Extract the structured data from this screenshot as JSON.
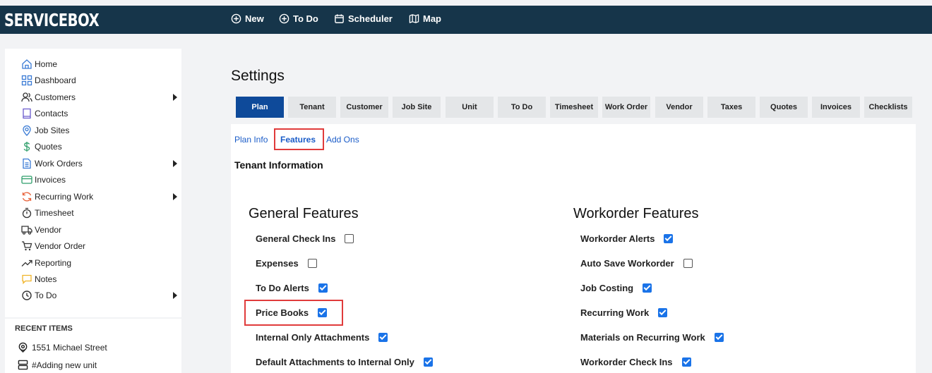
{
  "app": {
    "logo": "SERVICEBOX"
  },
  "topnav": {
    "new": "New",
    "todo": "To Do",
    "scheduler": "Scheduler",
    "map": "Map"
  },
  "sidebar": {
    "items": [
      {
        "label": "Home",
        "icon": "home-icon"
      },
      {
        "label": "Dashboard",
        "icon": "dashboard-icon"
      },
      {
        "label": "Customers",
        "icon": "customers-icon"
      },
      {
        "label": "Contacts",
        "icon": "contacts-icon"
      },
      {
        "label": "Job Sites",
        "icon": "location-pin-icon"
      },
      {
        "label": "Quotes",
        "icon": "dollar-icon"
      },
      {
        "label": "Work Orders",
        "icon": "document-icon"
      },
      {
        "label": "Invoices",
        "icon": "credit-card-icon"
      },
      {
        "label": "Recurring Work",
        "icon": "refresh-icon"
      },
      {
        "label": "Timesheet",
        "icon": "stopwatch-icon"
      },
      {
        "label": "Vendor",
        "icon": "truck-icon"
      },
      {
        "label": "Vendor Order",
        "icon": "cart-icon"
      },
      {
        "label": "Reporting",
        "icon": "trend-icon"
      },
      {
        "label": "Notes",
        "icon": "note-icon"
      },
      {
        "label": "To Do",
        "icon": "clock-icon"
      }
    ]
  },
  "recent": {
    "title": "RECENT ITEMS",
    "items": [
      {
        "label": "1551 Michael Street",
        "icon": "location-pin-icon"
      },
      {
        "label": "#Adding new unit",
        "icon": "server-icon"
      }
    ]
  },
  "page": {
    "title": "Settings"
  },
  "tabs": [
    "Plan",
    "Tenant",
    "Customer",
    "Job Site",
    "Unit",
    "To Do",
    "Timesheet",
    "Work Order",
    "Vendor",
    "Taxes",
    "Quotes",
    "Invoices",
    "Checklists"
  ],
  "subtabs": [
    "Plan Info",
    "Features",
    "Add Ons"
  ],
  "tenant_info": "Tenant Information",
  "general": {
    "title": "General Features",
    "features": [
      {
        "label": "General Check Ins",
        "checked": false
      },
      {
        "label": "Expenses",
        "checked": false
      },
      {
        "label": "To Do Alerts",
        "checked": true
      },
      {
        "label": "Price Books",
        "checked": true
      },
      {
        "label": "Internal Only Attachments",
        "checked": true
      },
      {
        "label": "Default Attachments to Internal Only",
        "checked": true
      }
    ]
  },
  "workorder": {
    "title": "Workorder Features",
    "features": [
      {
        "label": "Workorder Alerts",
        "checked": true
      },
      {
        "label": "Auto Save Workorder",
        "checked": false
      },
      {
        "label": "Job Costing",
        "checked": true
      },
      {
        "label": "Recurring Work",
        "checked": true
      },
      {
        "label": "Materials on Recurring Work",
        "checked": true
      },
      {
        "label": "Workorder Check Ins",
        "checked": true
      }
    ]
  },
  "colors": {
    "topbar": "#16354a",
    "active_tab": "#0e4a9a",
    "link": "#1a5cc8",
    "checkbox": "#1a73e8",
    "highlight": "#e03b3b"
  }
}
